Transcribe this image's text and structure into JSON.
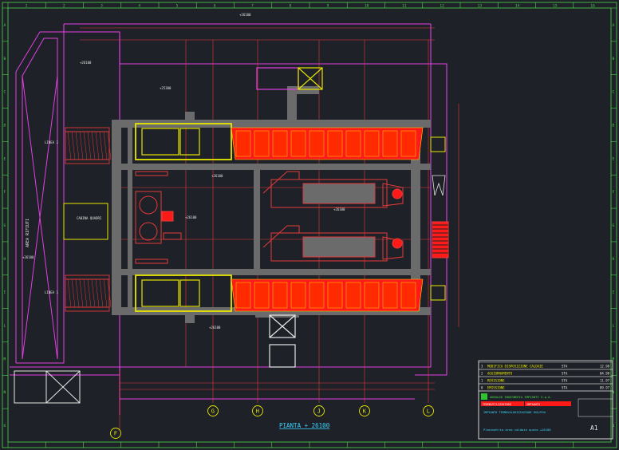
{
  "drawing": {
    "border_cols": [
      "1",
      "2",
      "3",
      "4",
      "5",
      "6",
      "7",
      "8",
      "9",
      "10",
      "11",
      "12",
      "13",
      "14",
      "15",
      "16"
    ],
    "border_rows": [
      "A",
      "B",
      "C",
      "D",
      "E",
      "F",
      "G",
      "H",
      "I",
      "L",
      "M",
      "N",
      "O"
    ],
    "grid_axes": [
      "F",
      "G",
      "H",
      "J",
      "K",
      "L"
    ],
    "plan_title": "PIANTA + 26100",
    "labels": {
      "side_area": "AREA RIFIUTI",
      "upper_unit": "LINEA 2",
      "lower_unit": "LINEA 1",
      "middle_box": "CABINA QUADRI",
      "top_tag": "+26100",
      "elev_1": "+25300",
      "elev_2": "+26100",
      "elev_3": "+26100",
      "elev_4": "+26100",
      "elev_5": "+26100",
      "elev_6": "+26100",
      "elev_7": "+26100"
    },
    "revisions": [
      {
        "no": "3",
        "desc": "MODIFICA DISPOSIZIONE CALDAIE",
        "by": "STA",
        "date": "12.98"
      },
      {
        "no": "2",
        "desc": "AGGIORNAMENTO",
        "by": "STA",
        "date": "04.98"
      },
      {
        "no": "1",
        "desc": "REVISIONE",
        "by": "STA",
        "date": "11.97"
      },
      {
        "no": "0",
        "desc": "EMISSIONE",
        "by": "STA",
        "date": "09.97"
      }
    ],
    "title_block": {
      "company": "ANSALDO INGEGNERIA IMPIANTI S.p.A.",
      "client_left": "TERMOUTILIZZATORE",
      "client_right": "IMPIANTO",
      "project": "IMPIANTO TERMOVALORIZZAZIONE RSU/RSA",
      "subtitle": "Planimetria area caldaie quota +26100",
      "sheet_size": "A1"
    }
  }
}
